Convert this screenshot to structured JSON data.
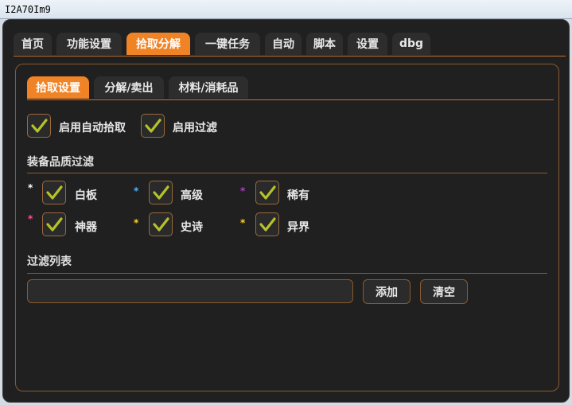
{
  "window": {
    "title": "I2A70Im9"
  },
  "main_tabs": [
    {
      "label": "首页"
    },
    {
      "label": "功能设置"
    },
    {
      "label": "拾取分解",
      "active": true
    },
    {
      "label": "一键任务"
    },
    {
      "label": "自动"
    },
    {
      "label": "脚本"
    },
    {
      "label": "设置"
    },
    {
      "label": "dbg"
    }
  ],
  "sub_tabs": [
    {
      "label": "拾取设置",
      "active": true
    },
    {
      "label": "分解/卖出"
    },
    {
      "label": "材料/消耗品"
    }
  ],
  "options": {
    "auto_pickup": {
      "label": "启用自动拾取",
      "checked": true
    },
    "enable_filter": {
      "label": "启用过滤",
      "checked": true
    }
  },
  "quality_section": {
    "title": "装备品质过滤",
    "items": [
      {
        "label": "白板",
        "star": "*",
        "star_color": "#ffffff",
        "checked": true
      },
      {
        "label": "高级",
        "star": "*",
        "star_color": "#4fb4ff",
        "checked": true
      },
      {
        "label": "稀有",
        "star": "*",
        "star_color": "#b23cc8",
        "checked": true
      },
      {
        "label": "神器",
        "star": "*",
        "star_color": "#ff4f9a",
        "checked": true
      },
      {
        "label": "史诗",
        "star": "*",
        "star_color": "#ffd21e",
        "checked": true
      },
      {
        "label": "异界",
        "star": "*",
        "star_color": "#ffd21e",
        "checked": true
      }
    ]
  },
  "filter_list": {
    "title": "过滤列表",
    "input_value": "",
    "add_label": "添加",
    "clear_label": "清空"
  },
  "colors": {
    "accent": "#f08326",
    "check": "#b5c22a",
    "border": "#8a5a2e"
  }
}
